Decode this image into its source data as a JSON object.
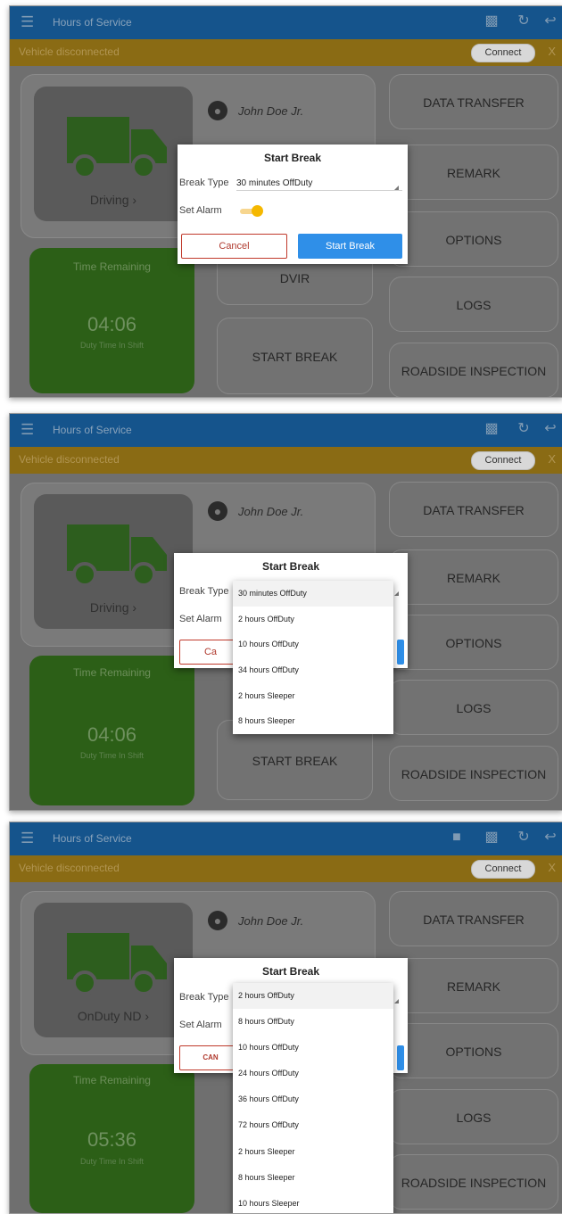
{
  "app": {
    "title": "Hours of Service",
    "menu_icon": "hamburger-menu-icon"
  },
  "banner": {
    "message": "Vehicle disconnected",
    "connect_label": "Connect",
    "close_label": "X"
  },
  "colors": {
    "appbar": "#15548c",
    "banner": "#8a6b14",
    "time_panel": "#2c5f17",
    "start_button": "#2f8fe8",
    "cancel_border": "#c0392b",
    "toggle_knob": "#f5b800"
  },
  "driver_name": "John Doe Jr.",
  "time_remaining_label": "Time Remaining",
  "duty_label": "Duty Time In Shift",
  "buttons": {
    "data_transfer": "DATA TRANSFER",
    "remark": "REMARK",
    "options": "OPTIONS",
    "logs": "LOGS",
    "roadside": "ROADSIDE INSPECTION",
    "dvir": "DVIR",
    "start_break": "START BREAK"
  },
  "dialog": {
    "title": "Start Break",
    "break_type_label": "Break Type",
    "set_alarm_label": "Set Alarm",
    "cancel": "Cancel",
    "cancel_caps": "CAN",
    "cancel_short": "Ca",
    "start": "Start Break"
  },
  "screens": [
    {
      "status": "Driving",
      "time_value": "04:06",
      "selected_break": "30 minutes OffDuty"
    },
    {
      "status": "Driving",
      "time_value": "04:06",
      "options": [
        "30 minutes OffDuty",
        "2 hours OffDuty",
        "10 hours OffDuty",
        "34 hours OffDuty",
        "2 hours Sleeper",
        "8 hours Sleeper"
      ]
    },
    {
      "status": "OnDuty ND",
      "time_value": "05:36",
      "options": [
        "2 hours OffDuty",
        "8 hours OffDuty",
        "10 hours OffDuty",
        "24 hours OffDuty",
        "36 hours OffDuty",
        "72 hours OffDuty",
        "2 hours Sleeper",
        "8 hours Sleeper",
        "10 hours Sleeper"
      ]
    }
  ]
}
